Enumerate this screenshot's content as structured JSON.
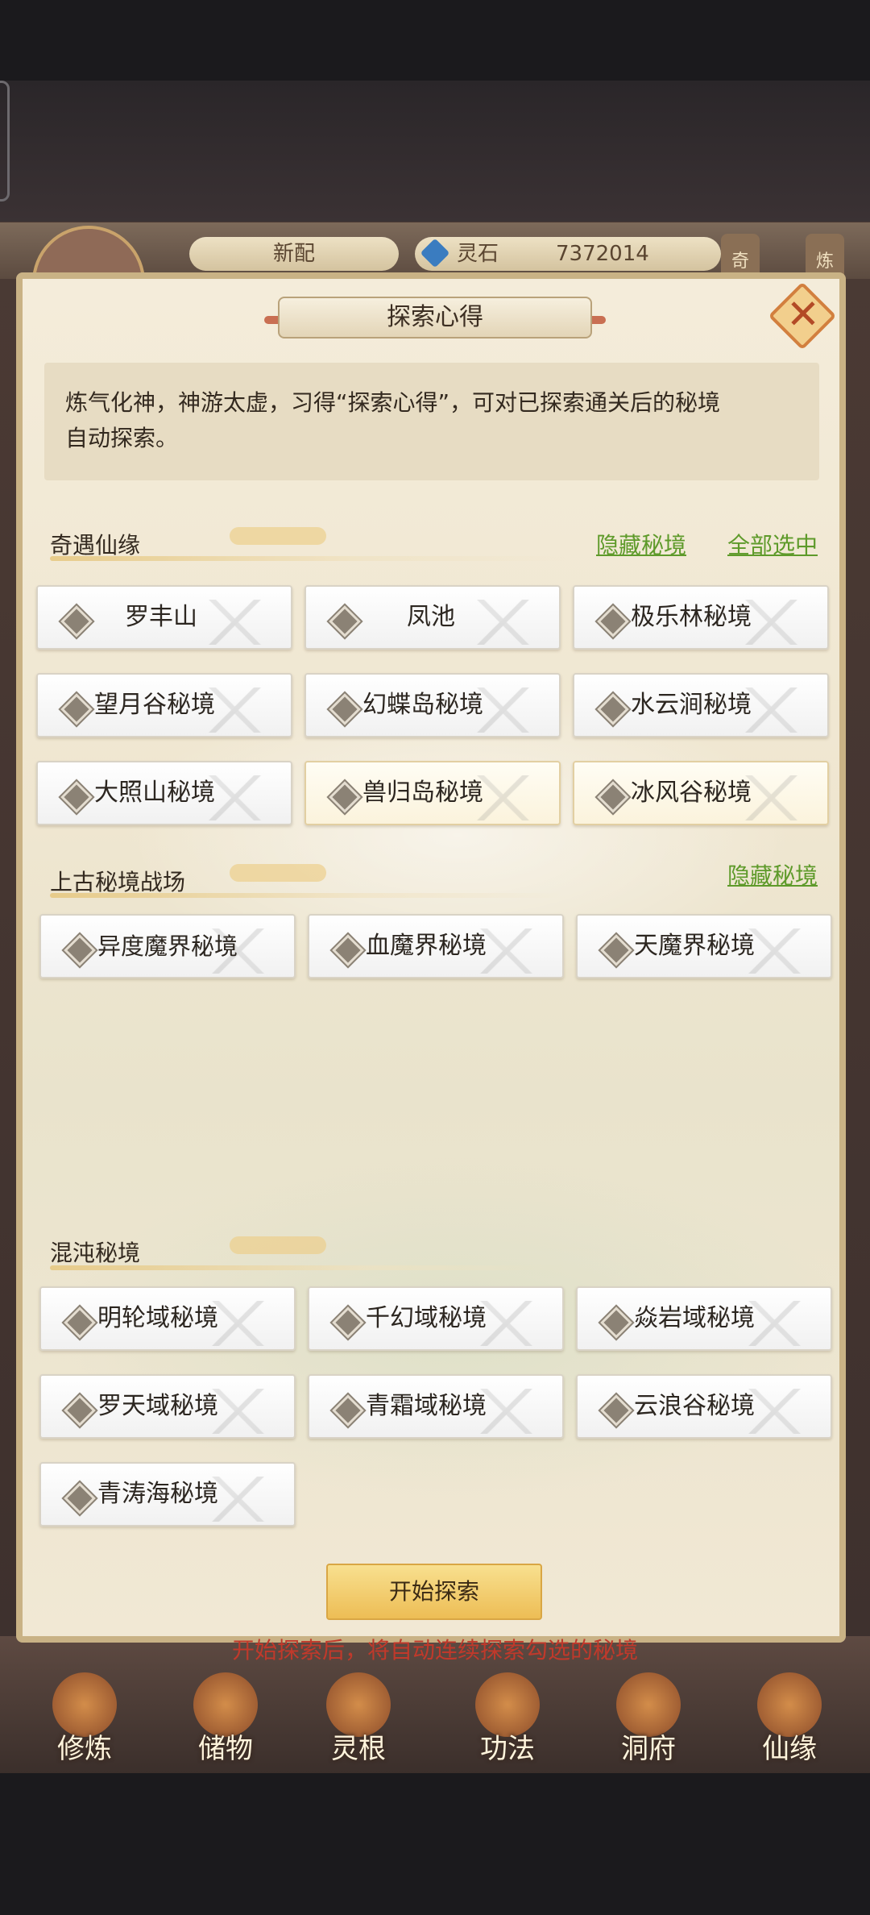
{
  "game_bg": {
    "pill_left": "新配",
    "spirit_stone_label": "灵石",
    "spirit_stone_value": "7372014",
    "right_badges": [
      "奇",
      "炼"
    ],
    "nav": [
      "修炼",
      "储物",
      "灵根",
      "功法",
      "洞府",
      "仙缘"
    ]
  },
  "modal": {
    "title": "探索心得",
    "close_icon": "close-icon",
    "description_line1": "炼气化神，神游太虚，习得“探索心得”，可对已探索通关后的秘境",
    "description_line2": "自动探索。",
    "sections": [
      {
        "title": "奇遇仙缘",
        "links": [
          "隐藏秘境",
          "全部选中"
        ],
        "items": [
          "罗丰山",
          "凤池",
          "极乐林秘境",
          "望月谷秘境",
          "幻蝶岛秘境",
          "水云涧秘境",
          "大照山秘境",
          "兽归岛秘境",
          "冰风谷秘境"
        ]
      },
      {
        "title": "上古秘境战场",
        "links": [
          "隐藏秘境"
        ],
        "items": [
          "异度魔界秘境",
          "血魔界秘境",
          "天魔界秘境"
        ]
      },
      {
        "title": "混沌秘境",
        "links": [],
        "items": [
          "明轮域秘境",
          "千幻域秘境",
          "焱岩域秘境",
          "罗天域秘境",
          "青霜域秘境",
          "云浪谷秘境",
          "青涛海秘境"
        ]
      }
    ],
    "start_button": "开始探索",
    "hint": "开始探索后，将自动连续探索勾选的秘境"
  },
  "colors": {
    "link": "#5e9a2a",
    "hint": "#c0392b",
    "button": "#edbd55"
  }
}
